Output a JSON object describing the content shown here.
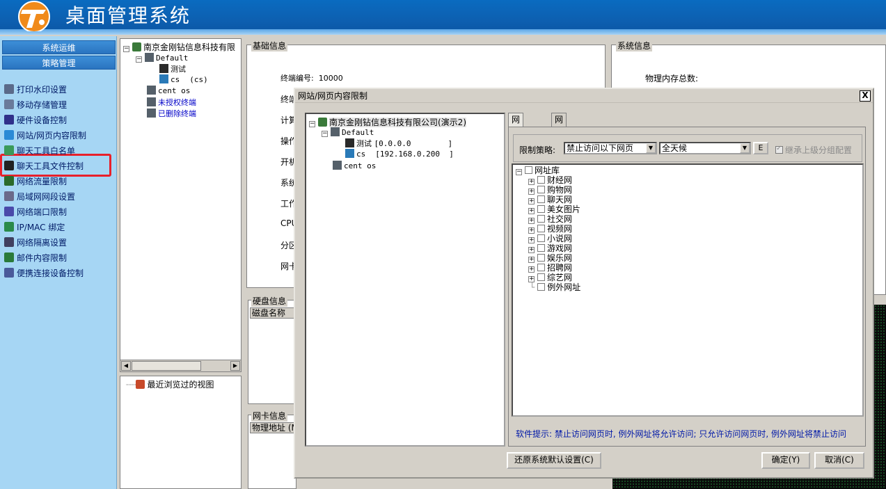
{
  "app": {
    "title": "桌面管理系统"
  },
  "sidebar": {
    "tabs": [
      "系统运维",
      "策略管理"
    ],
    "items": [
      {
        "label": "打印水印设置",
        "icon": "printer-icon",
        "color": "#5a6a8a"
      },
      {
        "label": "移动存储管理",
        "icon": "usb-storage-icon",
        "color": "#6a7a9a"
      },
      {
        "label": "硬件设备控制",
        "icon": "hardware-icon",
        "color": "#30308a"
      },
      {
        "label": "网站/网页内容限制",
        "icon": "ie-globe-icon",
        "color": "#2a8ad6"
      },
      {
        "label": "聊天工具白名单",
        "icon": "chat-whitelist-icon",
        "color": "#3a9a5a"
      },
      {
        "label": "聊天工具文件控制",
        "icon": "qq-penguin-icon",
        "color": "#222222"
      },
      {
        "label": "网络流量限制",
        "icon": "traffic-chart-icon",
        "color": "#2a6a2a"
      },
      {
        "label": "局域网网段设置",
        "icon": "lan-segment-icon",
        "color": "#6a6a8a"
      },
      {
        "label": "网络端口限制",
        "icon": "port-icon",
        "color": "#4a4aaa"
      },
      {
        "label": "IP/MAC 绑定",
        "icon": "ip-mac-globe-icon",
        "color": "#2a8a4a"
      },
      {
        "label": "网络隔离设置",
        "icon": "isolation-icon",
        "color": "#404060"
      },
      {
        "label": "邮件内容限制",
        "icon": "mail-icon",
        "color": "#2a7a3a"
      },
      {
        "label": "便携连接设备控制",
        "icon": "portable-device-icon",
        "color": "#4a5a9a"
      }
    ]
  },
  "org_tree": {
    "root": "南京金刚钻信息科技有限",
    "group": "Default",
    "terminals": [
      {
        "name": "测试",
        "detail": ""
      },
      {
        "name": "cs",
        "detail": "(cs)"
      }
    ],
    "other": "cent os",
    "unauthorized": "未授权终端",
    "deleted": "已删除终端"
  },
  "recent": {
    "label": "最近浏览过的视图"
  },
  "basic_info": {
    "title": "基础信息",
    "terminal_no_label": "终端编号:",
    "terminal_no_value": "10000",
    "partial_labels": [
      "终端",
      "计算",
      "操作",
      "开机",
      "系统",
      "工作",
      "CPU",
      "分区",
      "网卡"
    ]
  },
  "system_info": {
    "title": "系统信息",
    "mem_label": "物理内存总数:"
  },
  "disk_info": {
    "title": "硬盘信息",
    "col": "磁盘名称"
  },
  "nic_info": {
    "title": "网卡信息",
    "col": "物理地址 (M"
  },
  "dialog": {
    "title": "网站/网页内容限制",
    "close": "X",
    "tree": {
      "root": "南京金刚钻信息科技有限公司(演示2)",
      "group": "Default",
      "terminals": [
        {
          "name": "测试",
          "ip": "[0.0.0.0        ]"
        },
        {
          "name": "cs",
          "ip": "[192.168.0.200  ]"
        }
      ],
      "other": "cent os"
    },
    "tabs": [
      "网站限制",
      "网页内容限制"
    ],
    "strategy_label": "限制策略:",
    "strategy_value": "禁止访问以下网页",
    "time_value": "全天候",
    "e_button": "E",
    "inherit_label": "继承上级分组配置",
    "url_tree": {
      "root": "网址库",
      "items": [
        "财经网",
        "购物网",
        "聊天网",
        "美女图片",
        "社交网",
        "视频网",
        "小说网",
        "游戏网",
        "娱乐网",
        "招聘网",
        "综艺网"
      ],
      "exception": "例外网址"
    },
    "tip": "软件提示: 禁止访问网页时, 例外网址将允许访问; 只允许访问网页时, 例外网址将禁止访问",
    "restore_button": "还原系统默认设置(C)",
    "ok_button": "确定(Y)",
    "cancel_button": "取消(C)"
  }
}
